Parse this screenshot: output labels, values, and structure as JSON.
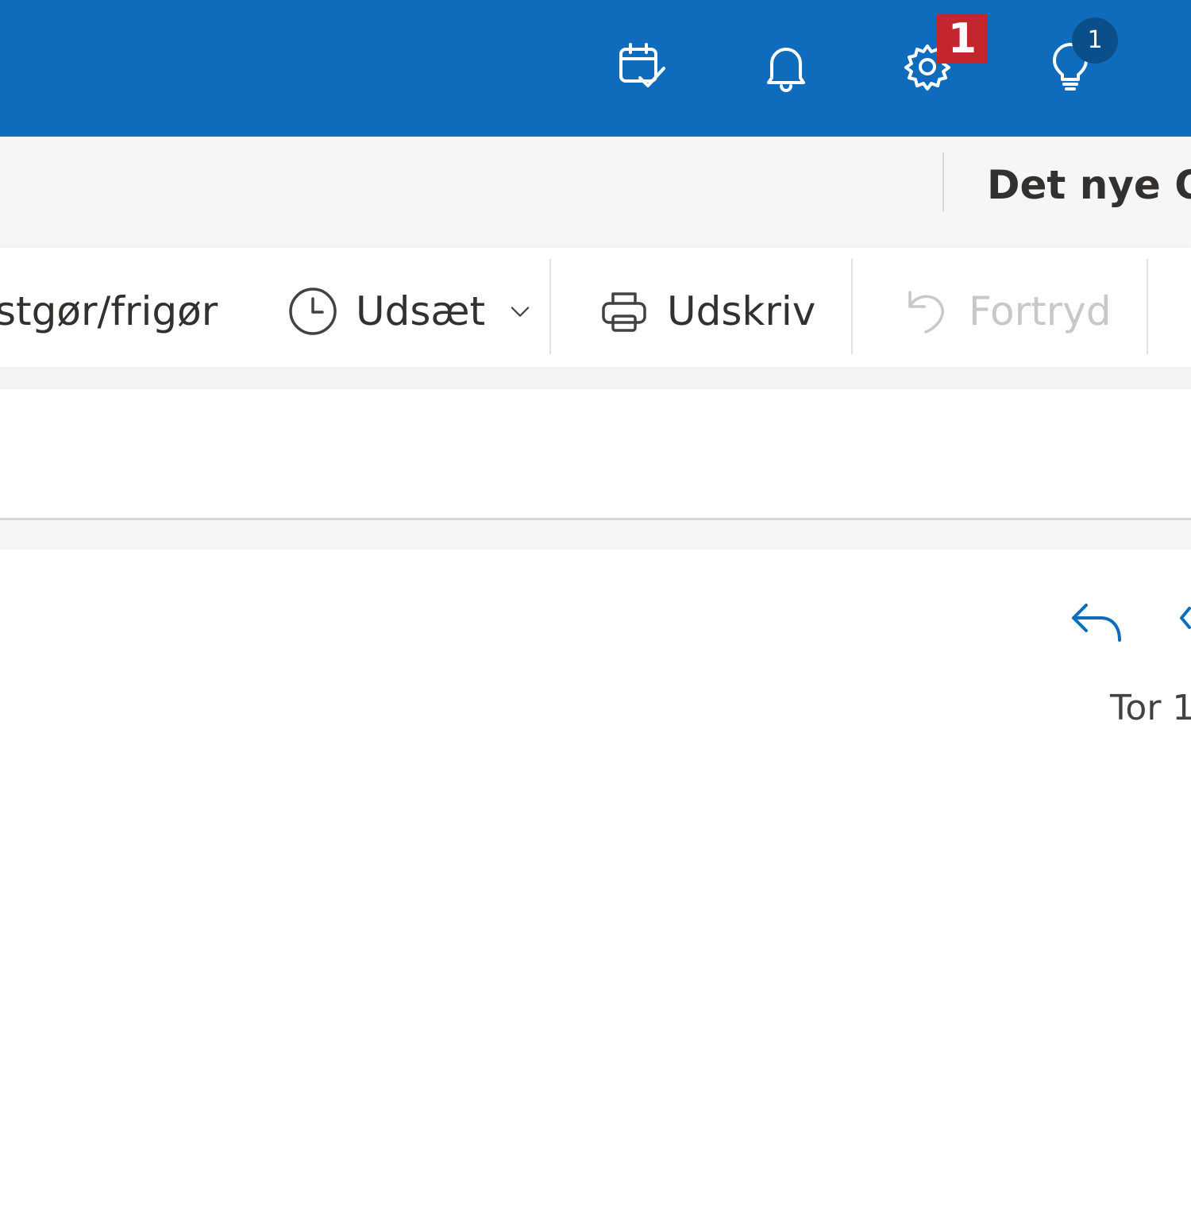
{
  "header": {
    "icons": [
      "calendar-check-icon",
      "bell-icon",
      "gear-icon",
      "lightbulb-icon"
    ],
    "settings_badge": "1",
    "tips_badge": "1",
    "colors": {
      "bar": "#0f6cbd",
      "red_badge": "#c4262e",
      "blue_badge": "#0b4f8a"
    }
  },
  "promo": {
    "text": "Det nye Ou"
  },
  "toolbar": {
    "pin_label": "stgør/frigør",
    "snooze_label": "Udsæt",
    "print_label": "Udskriv",
    "undo_label": "Fortryd"
  },
  "message": {
    "date": "Tor 1"
  }
}
